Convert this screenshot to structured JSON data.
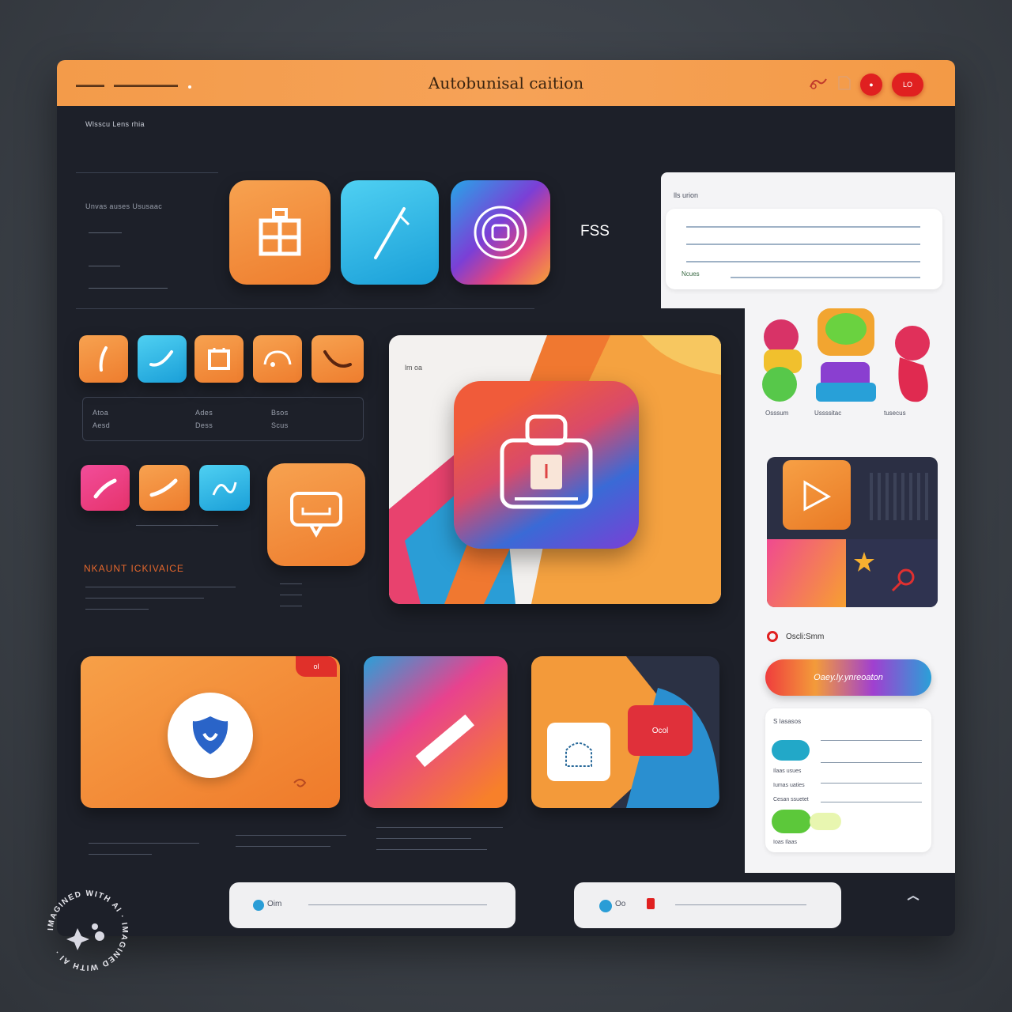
{
  "titlebar": {
    "menu_left": [
      "▬▬▬▬",
      "▬▬▬▬▬▬▬▬▬"
    ],
    "title": "Autobunisal caition",
    "icons": [
      "brush-icon",
      "document-icon"
    ],
    "badge": "LO"
  },
  "sidebar": {
    "breadcrumb": "Wlsscu Lens rhia",
    "subtitle": "Unvas auses Ususaac",
    "section_heading": "NKAUNT ICKIVAICE",
    "stats": [
      {
        "label": "Atoa",
        "value": "Aesd"
      },
      {
        "label": "Ades",
        "value": "Dess"
      },
      {
        "label": "Bsos",
        "value": "Scus"
      }
    ]
  },
  "main": {
    "label_fs": "FSS",
    "hero_tag": "lm oa"
  },
  "right_panel": {
    "header": "lls urion",
    "form_caption": "Ncues",
    "sticker_labels": [
      "Osssum",
      "Ussssitac",
      "tusecus"
    ],
    "radio_label": "Oscli:Smm",
    "gradient_button": "Oaey.ly.ynreoaton",
    "list_title": "S Iasasos",
    "list_rows": [
      "Ilaas usues",
      "Iumas uaties",
      "Cesan ssuetet",
      "Ioas Ilaas"
    ]
  },
  "cards": {
    "orange_badge": "ol",
    "tile_badge": "Ocol"
  },
  "bottom_bar": {
    "left_label": "Oim",
    "right_label": "Oo"
  },
  "watermark": {
    "text": "IMAGINED WITH AI · IMAGINED WITH AI ·"
  },
  "colors": {
    "accent": "#f39b4a",
    "window": "#1d2029",
    "panel": "#f4f4f6",
    "danger": "#e02020"
  }
}
